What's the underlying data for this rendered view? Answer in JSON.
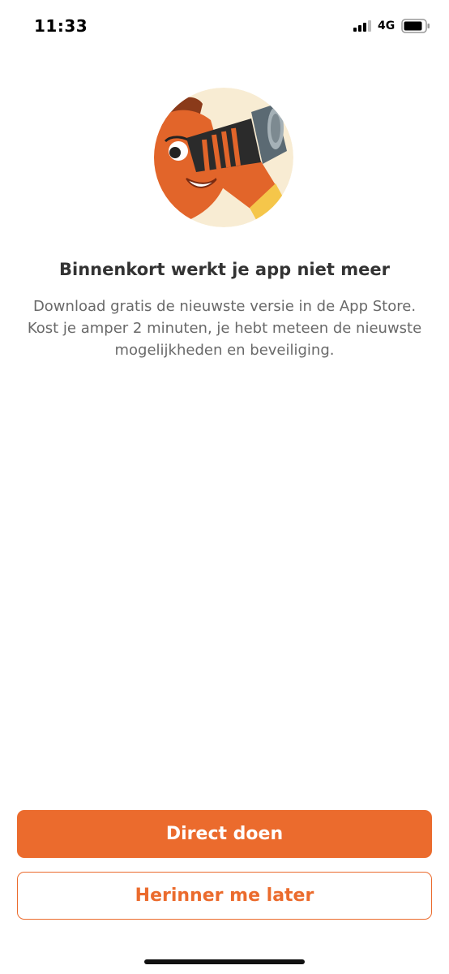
{
  "status_bar": {
    "time": "11:33",
    "network": "4G",
    "icons": [
      "signal-bars-icon",
      "battery-icon"
    ]
  },
  "illustration": {
    "icon": "person-with-binoculars-illustration",
    "colors": {
      "background": "#f8ecd3",
      "skin": "#e2652a",
      "lens": "#5b6a73",
      "cuff": "#f5c64a"
    }
  },
  "content": {
    "title": "Binnenkort werkt je app niet meer",
    "body": "Download gratis de nieuwste versie in de App Store. Kost je amper 2 minuten, je hebt meteen de nieuwste mogelijkheden en beveiliging."
  },
  "actions": {
    "primary_label": "Direct doen",
    "secondary_label": "Herinner me later",
    "accent_color": "#eb6b2d"
  }
}
